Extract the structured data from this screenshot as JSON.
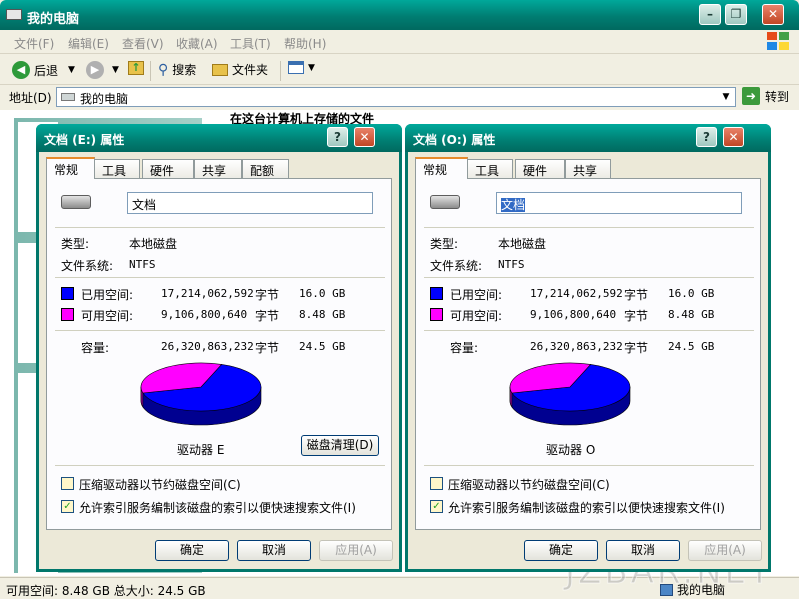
{
  "window": {
    "title": "我的电脑",
    "controls": {
      "minimize": "0",
      "restore": "1",
      "close": "r"
    }
  },
  "menu": [
    "文件(F)",
    "编辑(E)",
    "查看(V)",
    "收藏(A)",
    "工具(T)",
    "帮助(H)"
  ],
  "toolbar": {
    "back": "后退",
    "search": "搜索",
    "folders": "文件夹"
  },
  "address": {
    "label": "地址(D)",
    "value": "我的电脑",
    "go": "转到"
  },
  "content": {
    "heading": "在这台计算机上存储的文件"
  },
  "status": {
    "text": "可用空间: 8.48 GB 总大小: 24.5 GB",
    "location": "我的电脑"
  },
  "watermark": "JZBAR.NET",
  "colors": {
    "used": "#0000ff",
    "free": "#ff00ff",
    "title_bar": "#00897b"
  },
  "dialogs": [
    {
      "title": "文档 (E:) 属性",
      "tabs": [
        "常规",
        "工具",
        "硬件",
        "共享",
        "配额"
      ],
      "active_tab": "常规",
      "name": "文档",
      "name_selected": false,
      "type_label": "类型:",
      "type_value": "本地磁盘",
      "fs_label": "文件系统:",
      "fs_value": "NTFS",
      "used_label": "已用空间:",
      "used_bytes": "17,214,062,592",
      "used_unit": "字节",
      "used_human": "16.0 GB",
      "free_label": "可用空间:",
      "free_bytes": "9,106,800,640",
      "free_unit": "字节",
      "free_human": "8.48 GB",
      "cap_label": "容量:",
      "cap_bytes": "26,320,863,232",
      "cap_unit": "字节",
      "cap_human": "24.5 GB",
      "drive_label": "驱动器 E",
      "cleanup": "磁盘清理(D)",
      "compress": "压缩驱动器以节约磁盘空间(C)",
      "compress_checked": false,
      "index": "允许索引服务编制该磁盘的索引以便快速搜索文件(I)",
      "index_checked": true,
      "ok": "确定",
      "cancel": "取消",
      "apply": "应用(A)"
    },
    {
      "title": "文档 (O:) 属性",
      "tabs": [
        "常规",
        "工具",
        "硬件",
        "共享"
      ],
      "active_tab": "常规",
      "name": "文档",
      "name_selected": true,
      "type_label": "类型:",
      "type_value": "本地磁盘",
      "fs_label": "文件系统:",
      "fs_value": "NTFS",
      "used_label": "已用空间:",
      "used_bytes": "17,214,062,592",
      "used_unit": "字节",
      "used_human": "16.0 GB",
      "free_label": "可用空间:",
      "free_bytes": "9,106,800,640",
      "free_unit": "字节",
      "free_human": "8.48 GB",
      "cap_label": "容量:",
      "cap_bytes": "26,320,863,232",
      "cap_unit": "字节",
      "cap_human": "24.5 GB",
      "drive_label": "驱动器 O",
      "compress": "压缩驱动器以节约磁盘空间(C)",
      "compress_checked": false,
      "index": "允许索引服务编制该磁盘的索引以便快速搜索文件(I)",
      "index_checked": true,
      "ok": "确定",
      "cancel": "取消",
      "apply": "应用(A)"
    }
  ]
}
